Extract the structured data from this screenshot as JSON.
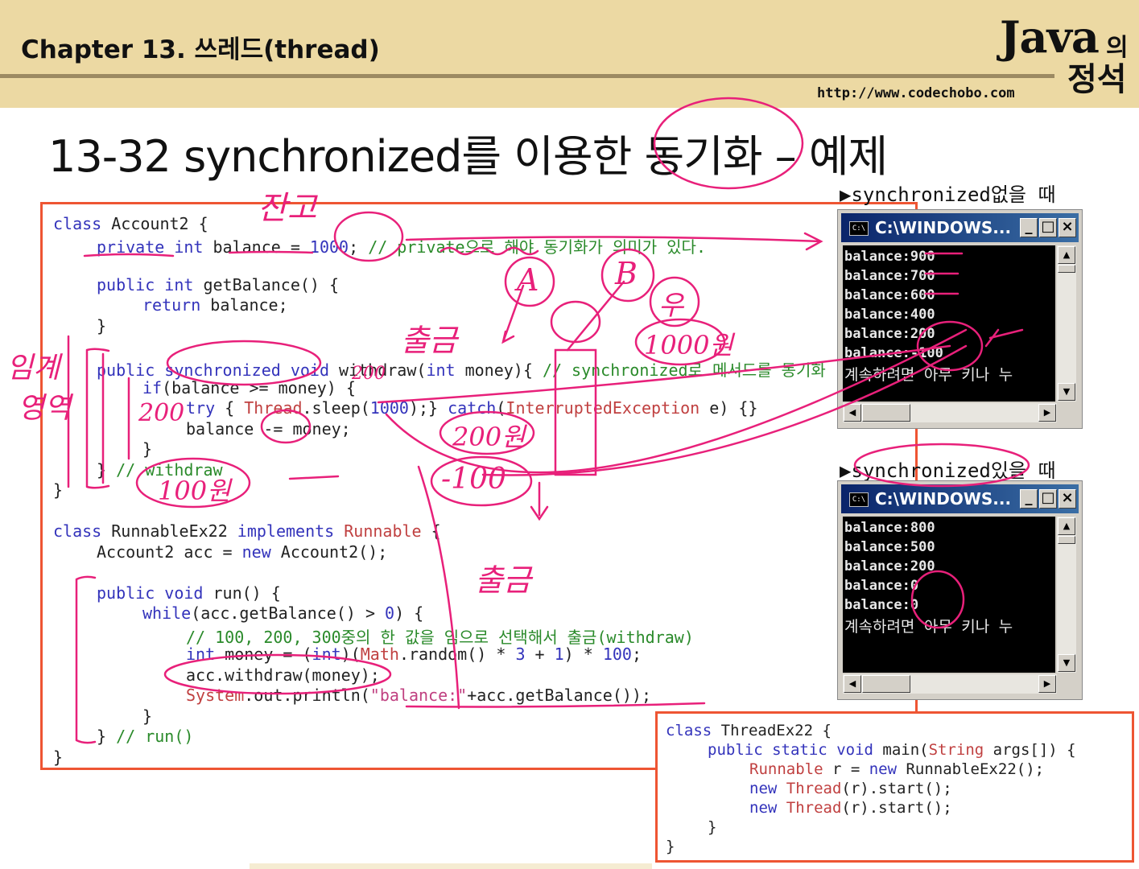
{
  "header": {
    "chapter_title": "Chapter 13. 쓰레드(thread)",
    "logo_java": "Java",
    "logo_ui": "의",
    "logo_jeongseok": "정석",
    "url": "http://www.codechobo.com"
  },
  "slide_title": "13-32 synchronized를 이용한 동기화 – 예제",
  "code_main": {
    "l1": [
      "class",
      " Account2 {"
    ],
    "l2": [
      "private",
      " ",
      "int",
      " balance = ",
      "1000",
      "; ",
      "// private으로 해야 동기화가 의미가 있다."
    ],
    "l3": [
      "public",
      " ",
      "int",
      " getBalance() {"
    ],
    "l4": [
      "return",
      " balance;"
    ],
    "l5": "}",
    "l6": [
      "public",
      " ",
      "synchronized",
      " ",
      "void",
      " withdraw(",
      "int",
      " money){ ",
      "// synchronized로 메서드를 동기화"
    ],
    "l7": [
      "if",
      "(balance >= money) {"
    ],
    "l8": [
      "try",
      " { ",
      "Thread",
      ".sleep(",
      "1000",
      ");} ",
      "catch",
      "(",
      "InterruptedException",
      " e) {}"
    ],
    "l9": "balance -= money;",
    "l10": "}",
    "l11": [
      "} ",
      "// withdraw"
    ],
    "l12": "}",
    "l13": [
      "class",
      " RunnableEx22 ",
      "implements",
      " ",
      "Runnable",
      " {"
    ],
    "l14": [
      "Account2 acc = ",
      "new",
      " Account2();"
    ],
    "l15": [
      "public",
      " ",
      "void",
      " run() {"
    ],
    "l16": [
      "while",
      "(acc.getBalance() > ",
      "0",
      ") {"
    ],
    "l17": "// 100, 200, 300중의 한 값을 임으로 선택해서 출금(withdraw)",
    "l18": [
      "int",
      " money = (",
      "int",
      ")(",
      "Math",
      ".random() * ",
      "3",
      " + ",
      "1",
      ") * ",
      "100",
      ";"
    ],
    "l19": "acc.withdraw(money);",
    "l20": [
      "System",
      ".out.println(",
      "\"balance:\"",
      "+acc.getBalance());"
    ],
    "l21": "}",
    "l22": [
      "} ",
      "// run()"
    ],
    "l23": "}"
  },
  "code_second": {
    "l1": [
      "class",
      " ThreadEx22 {"
    ],
    "l2": [
      "public",
      " ",
      "static",
      " ",
      "void",
      " main(",
      "String",
      " args[]) {"
    ],
    "l3": [
      "Runnable",
      " r = ",
      "new",
      " RunnableEx22();"
    ],
    "l4": [
      "new",
      " ",
      "Thread",
      "(r).start();"
    ],
    "l5": [
      "new",
      " ",
      "Thread",
      "(r).start();"
    ],
    "l6": "}",
    "l7": "}"
  },
  "label_without": "▶synchronized없을 때",
  "label_with": "▶synchronized있을 때",
  "console_without": {
    "title": "C:\\WINDOWS...",
    "lines": [
      "balance:900",
      "balance:700",
      "balance:600",
      "balance:400",
      "balance:200",
      "balance:-100",
      "계속하려면 아무 키나 누"
    ]
  },
  "console_with": {
    "title": "C:\\WINDOWS...",
    "lines": [
      "balance:800",
      "balance:500",
      "balance:200",
      "balance:0",
      "balance:0",
      "계속하려면 아무 키나 누"
    ]
  },
  "window_buttons": {
    "minimize": "_",
    "maximize": "□",
    "close": "×"
  },
  "annotations": {
    "janco": "잔고",
    "imgye_top": "임계",
    "imgye_bottom": "영역",
    "A": "A",
    "B": "B",
    "circle_top": "우",
    "amount_1000": "1000원",
    "chulgeum": "출금",
    "num_200_a": "200",
    "num_200_b": "200",
    "amount_200": "200원",
    "minus_100": "-100",
    "amount_100": "100원",
    "chulgeum2": "출금"
  },
  "colors": {
    "header_bg": "#ecd9a3",
    "box_border": "#ee5533",
    "annotation_pink": "#e8207a",
    "keyword_blue": "#3333bb",
    "comment_green": "#2a8a2a",
    "string_pink": "#c04080",
    "class_red": "#c04040"
  }
}
